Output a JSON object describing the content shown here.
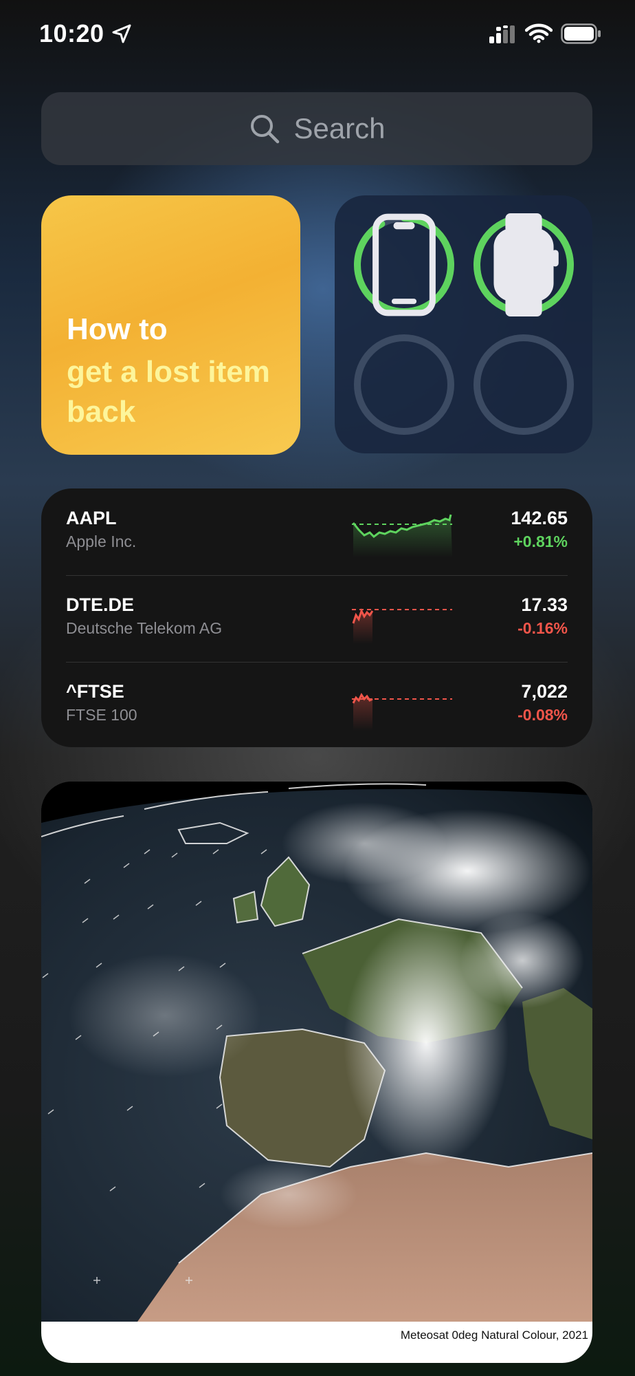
{
  "status": {
    "time": "10:20",
    "icons": [
      "location-arrow-icon",
      "cellular-signal-icon",
      "wifi-icon",
      "battery-icon"
    ]
  },
  "search": {
    "placeholder": "Search",
    "icon": "magnifying-glass-icon"
  },
  "tips_widget": {
    "line1": "How to",
    "line2": "get a lost item back",
    "colors": {
      "bg_start": "#f6c648",
      "bg_end": "#f3b133",
      "highlight": "#fdf59b"
    }
  },
  "batteries_widget": {
    "devices": [
      {
        "icon": "iphone-icon",
        "level": 0.92
      },
      {
        "icon": "apple-watch-icon",
        "level": 0.98
      },
      {
        "icon": "",
        "level": 0
      },
      {
        "icon": "",
        "level": 0
      }
    ],
    "ring_color": "#5ed35e"
  },
  "stocks": [
    {
      "symbol": "AAPL",
      "name": "Apple Inc.",
      "price": "142.65",
      "change": "+0.81%",
      "trend": "up",
      "color": "#5ed35e"
    },
    {
      "symbol": "DTE.DE",
      "name": "Deutsche Telekom AG",
      "price": "17.33",
      "change": "-0.16%",
      "trend": "down",
      "color": "#f0554a"
    },
    {
      "symbol": "^FTSE",
      "name": "FTSE 100",
      "price": "7,022",
      "change": "-0.08%",
      "trend": "down",
      "color": "#f0554a"
    }
  ],
  "satellite": {
    "caption": "Meteosat 0deg Natural Colour, 2021"
  }
}
